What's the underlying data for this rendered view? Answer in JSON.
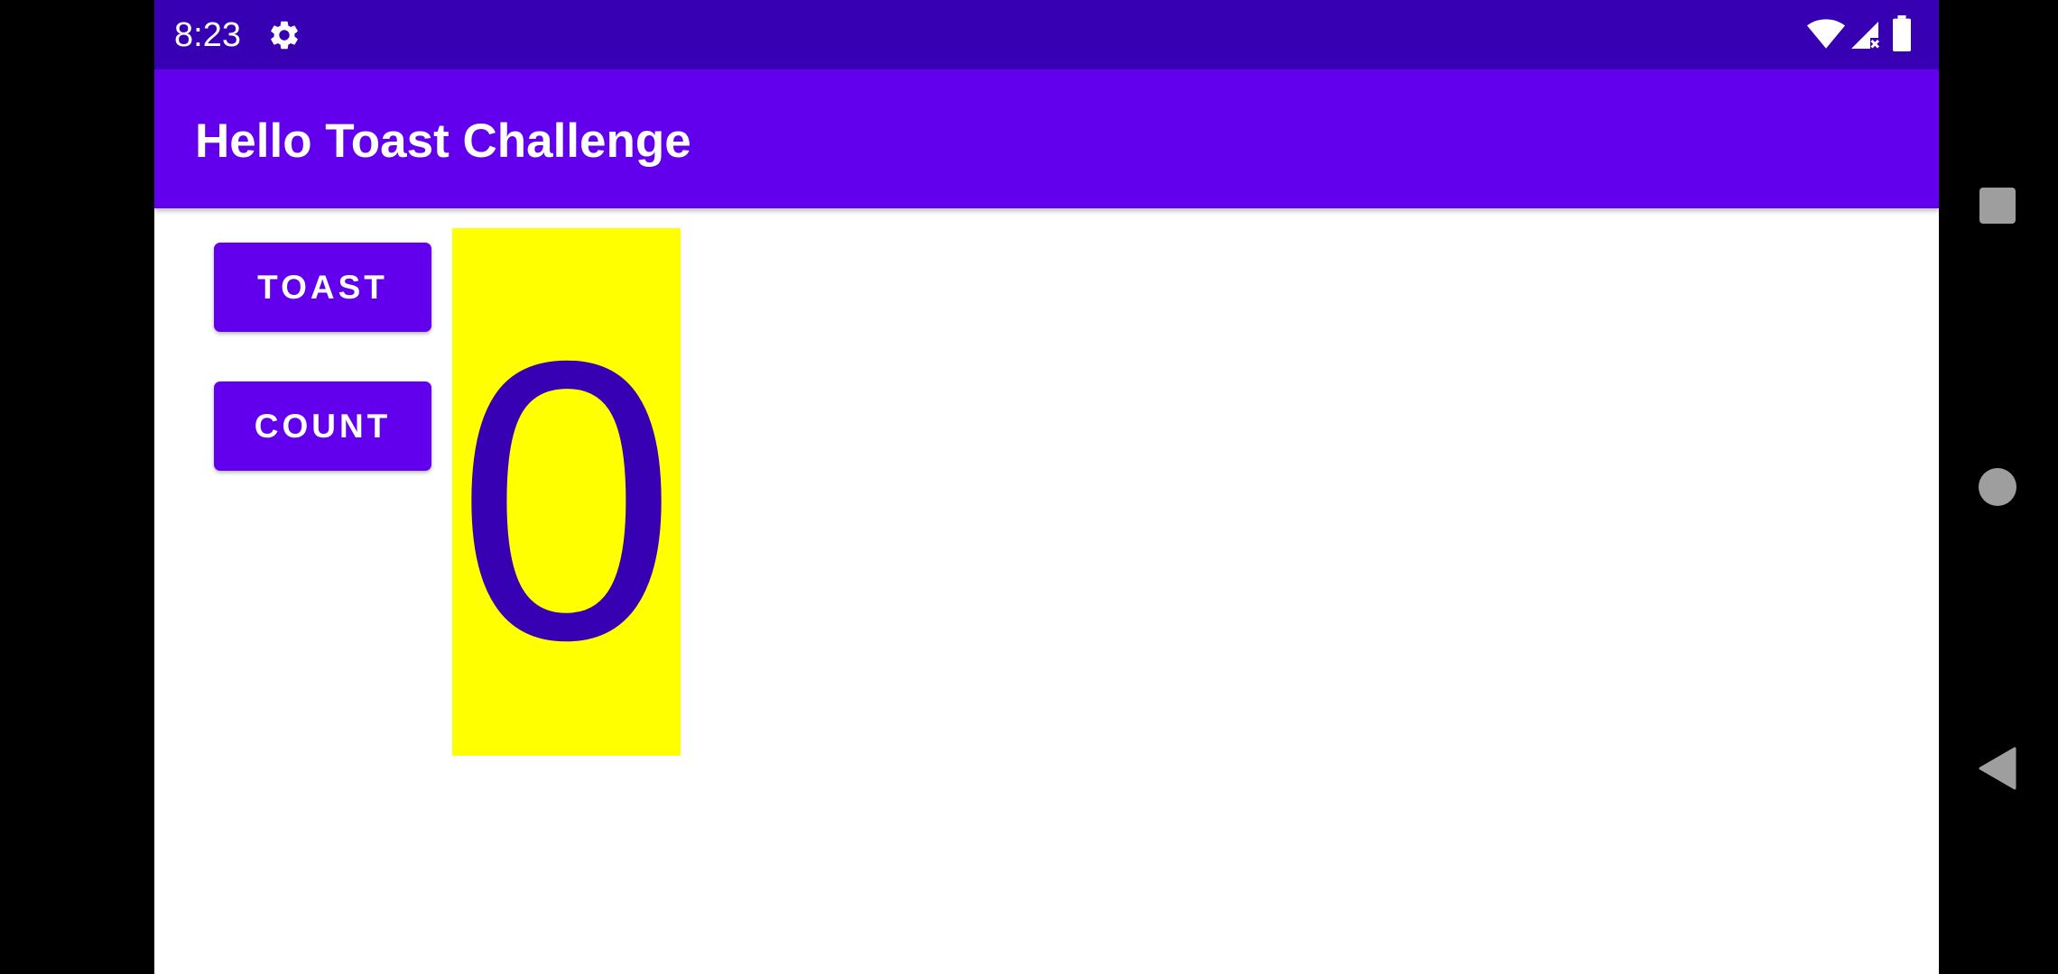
{
  "status_bar": {
    "time": "8:23",
    "icons": [
      "gear-icon",
      "wifi-icon",
      "signal-icon",
      "battery-icon"
    ],
    "background_color": "#3700b3"
  },
  "app_bar": {
    "title": "Hello Toast Challenge",
    "background_color": "#6200ee"
  },
  "buttons": {
    "toast_label": "TOAST",
    "count_label": "COUNT",
    "color": "#6200ee"
  },
  "counter": {
    "value": "0",
    "text_color": "#3700b3",
    "background_color": "#ffff00"
  },
  "nav_bar": {
    "icons": [
      "recents-icon",
      "home-icon",
      "back-icon"
    ]
  }
}
